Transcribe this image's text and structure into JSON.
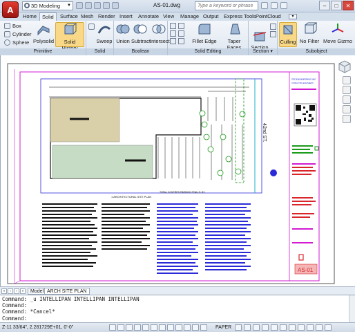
{
  "app": {
    "logo": "A",
    "workspace": "3D Modeling",
    "document_title": "AS-01.dwg",
    "search_placeholder": "Type a keyword or phrase"
  },
  "window_controls": [
    "–",
    "□",
    "✕"
  ],
  "tabs": [
    {
      "label": "Home",
      "active": false
    },
    {
      "label": "Solid",
      "active": true
    },
    {
      "label": "Surface",
      "active": false
    },
    {
      "label": "Mesh",
      "active": false
    },
    {
      "label": "Render",
      "active": false
    },
    {
      "label": "Insert",
      "active": false
    },
    {
      "label": "Annotate",
      "active": false
    },
    {
      "label": "View",
      "active": false
    },
    {
      "label": "Manage",
      "active": false
    },
    {
      "label": "Output",
      "active": false
    },
    {
      "label": "Express Tools",
      "active": false
    },
    {
      "label": "PointCloud",
      "active": false
    }
  ],
  "ribbon": {
    "primitive": {
      "title": "Primitive",
      "small_buttons": [
        "Box",
        "Cylinder",
        "Sphere"
      ],
      "polysolid": "Polysolid",
      "solid_history": "Solid History"
    },
    "solid": {
      "title": "Solid",
      "sweep": "Sweep"
    },
    "boolean": {
      "title": "Boolean",
      "union": "Union",
      "subtract": "Subtract",
      "intersect": "Intersect"
    },
    "solid_editing": {
      "title": "Solid Editing",
      "fillet_edge": "Fillet Edge",
      "taper_faces": "Taper Faces"
    },
    "section": {
      "title": "Section ▾",
      "section_plane": "Section\nPlane"
    },
    "subobject": {
      "title": "Subobject",
      "culling": "Culling",
      "no_filter": "No Filter",
      "move_gizmo": "Move Gizmo"
    }
  },
  "drawing": {
    "street_label": "42nd ST.",
    "sheet_id": "AS-01",
    "firm_name": "ZZZ ENGINEERING INC.",
    "firm_sub": "CONSULTING ENGINEERS",
    "plan_title": "1 ARCHITECTURAL SITE PLAN",
    "parking_note": "TOTAL COVERED PARKING STALLS: 83",
    "colors": {
      "magenta": "#d21ad2",
      "red": "#d8262b",
      "blue": "#2a2ad8",
      "green": "#1a9a1a",
      "cyan": "#18b0c8",
      "black": "#111111"
    }
  },
  "layout_tabs": {
    "model": "Model",
    "arch_site_plan": "ARCH SITE PLAN"
  },
  "command_lines": [
    "Command: _u INTELLIPAN INTELLIPAN INTELLIPAN",
    "Command:",
    "Command: *Cancel*",
    "Command:"
  ],
  "status": {
    "coords": "Z-11 33/64\", 2.281729E+01, 0'-0\"",
    "paper": "PAPER"
  }
}
